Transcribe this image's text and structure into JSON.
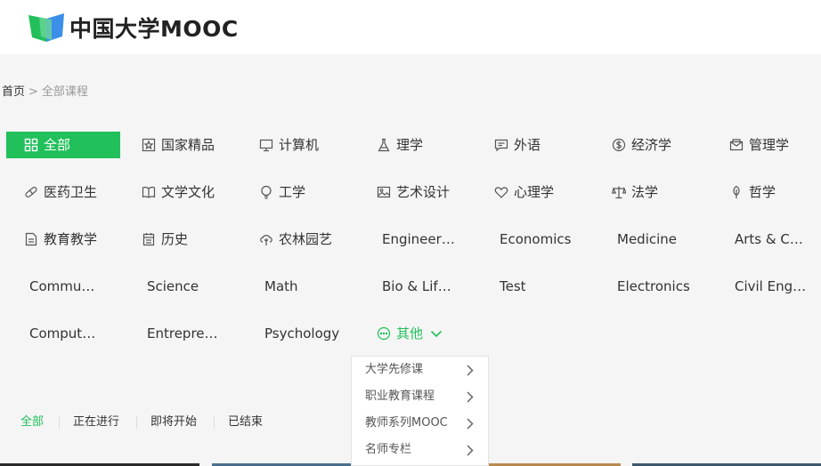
{
  "header": {
    "logo_text": "中国大学MOOC"
  },
  "breadcrumb": {
    "home": "首页",
    "separator": ">",
    "current": "全部课程"
  },
  "categories": [
    {
      "label": "全部",
      "icon": "grid-icon"
    },
    {
      "label": "国家精品",
      "icon": "star-badge-icon"
    },
    {
      "label": "计算机",
      "icon": "monitor-icon"
    },
    {
      "label": "理学",
      "icon": "flask-icon"
    },
    {
      "label": "外语",
      "icon": "chat-icon"
    },
    {
      "label": "经济学",
      "icon": "dollar-icon"
    },
    {
      "label": "管理学",
      "icon": "envelope-icon"
    },
    {
      "label": "医药卫生",
      "icon": "pill-icon"
    },
    {
      "label": "文学文化",
      "icon": "book-icon"
    },
    {
      "label": "工学",
      "icon": "bulb-icon"
    },
    {
      "label": "艺术设计",
      "icon": "picture-icon"
    },
    {
      "label": "心理学",
      "icon": "heart-icon"
    },
    {
      "label": "法学",
      "icon": "scale-icon"
    },
    {
      "label": "哲学",
      "icon": "leaf-icon"
    },
    {
      "label": "教育教学",
      "icon": "document-icon"
    },
    {
      "label": "历史",
      "icon": "calendar-icon"
    },
    {
      "label": "农林园艺",
      "icon": "plant-icon"
    },
    {
      "label": "Engineering",
      "icon": ""
    },
    {
      "label": "Economics",
      "icon": ""
    },
    {
      "label": "Medicine",
      "icon": ""
    },
    {
      "label": "Arts & Culture",
      "icon": ""
    },
    {
      "label": "Communication",
      "icon": ""
    },
    {
      "label": "Science",
      "icon": ""
    },
    {
      "label": "Math",
      "icon": ""
    },
    {
      "label": "Bio & Life Sciences",
      "icon": ""
    },
    {
      "label": "Test",
      "icon": ""
    },
    {
      "label": "Electronics",
      "icon": ""
    },
    {
      "label": "Civil Engineering",
      "icon": ""
    },
    {
      "label": "Computer Science",
      "icon": ""
    },
    {
      "label": "Entrepreneurship",
      "icon": ""
    },
    {
      "label": "Psychology",
      "icon": ""
    },
    {
      "label": "其他",
      "icon": "more-circle-icon"
    }
  ],
  "dropdown": {
    "items": [
      {
        "label": "大学先修课"
      },
      {
        "label": "职业教育课程"
      },
      {
        "label": "教师系列MOOC"
      },
      {
        "label": "名师专栏"
      }
    ]
  },
  "status_tabs": [
    {
      "label": "全部"
    },
    {
      "label": "正在进行"
    },
    {
      "label": "即将开始"
    },
    {
      "label": "已结束"
    }
  ],
  "colors": {
    "accent": "#21c05b",
    "text": "#333333",
    "muted": "#999999"
  }
}
